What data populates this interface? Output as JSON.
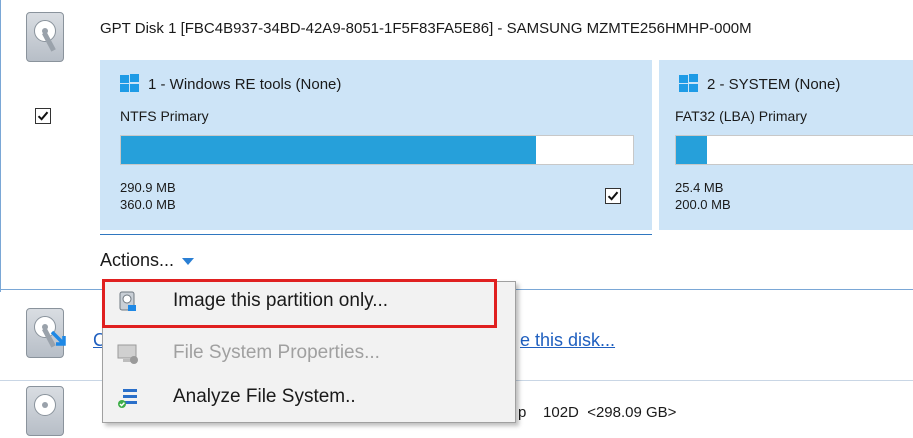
{
  "disk": {
    "title": "GPT Disk 1 [FBC4B937-34BD-42A9-8051-1F5F83FA5E86] - SAMSUNG MZMTE256HMHP-000M",
    "checked": true
  },
  "partitions": [
    {
      "title": "1 - Windows RE tools (None)",
      "fs": "NTFS Primary",
      "used": "290.9 MB",
      "total": "360.0 MB",
      "usage_fraction": 0.81,
      "checked": true
    },
    {
      "title": "2 - SYSTEM (None)",
      "fs": "FAT32 (LBA) Primary",
      "used": "25.4 MB",
      "total": "200.0 MB",
      "usage_fraction": 0.13
    }
  ],
  "actions": {
    "label": "Actions..."
  },
  "background": {
    "link_prefix": "C",
    "link_suffix": "e this disk...",
    "row_text": "p    102D  <298.09 GB>"
  },
  "menu": {
    "items": [
      {
        "label": "Image this partition only...",
        "icon": "image-partition-icon",
        "enabled": true,
        "highlighted": true
      },
      {
        "label": "File System Properties...",
        "icon": "file-system-properties-icon",
        "enabled": false
      },
      {
        "label": "Analyze File System..",
        "icon": "analyze-file-system-icon",
        "enabled": true
      }
    ]
  },
  "colors": {
    "partition_bg": "#cde4f7",
    "bar_fill": "#26a0da",
    "accent": "#2a7fd4",
    "highlight": "#e02020"
  }
}
